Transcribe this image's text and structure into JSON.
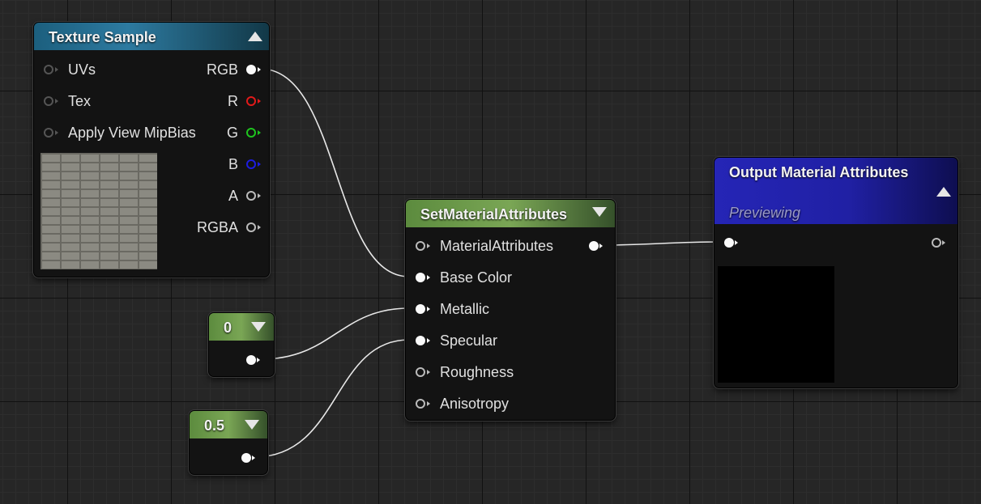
{
  "texture_sample": {
    "title": "Texture Sample",
    "inputs": [
      "UVs",
      "Tex",
      "Apply View MipBias"
    ],
    "outputs": [
      "RGB",
      "R",
      "G",
      "B",
      "A",
      "RGBA"
    ]
  },
  "const_0": {
    "value": "0"
  },
  "const_05": {
    "value": "0.5"
  },
  "set_material_attributes": {
    "title": "SetMaterialAttributes",
    "output": "MaterialAttributes",
    "inputs": [
      "Base Color",
      "Metallic",
      "Specular",
      "Roughness",
      "Anisotropy"
    ]
  },
  "output_material_attributes": {
    "title": "Output Material Attributes",
    "subtitle": "Previewing"
  },
  "colors": {
    "texture_header": "#1c5f7e",
    "constant_header": "#5c8b3e",
    "output_header": "#2525b6",
    "pin_red": "#e21a1a",
    "pin_green": "#1ec51e",
    "pin_blue": "#1d1de0"
  }
}
